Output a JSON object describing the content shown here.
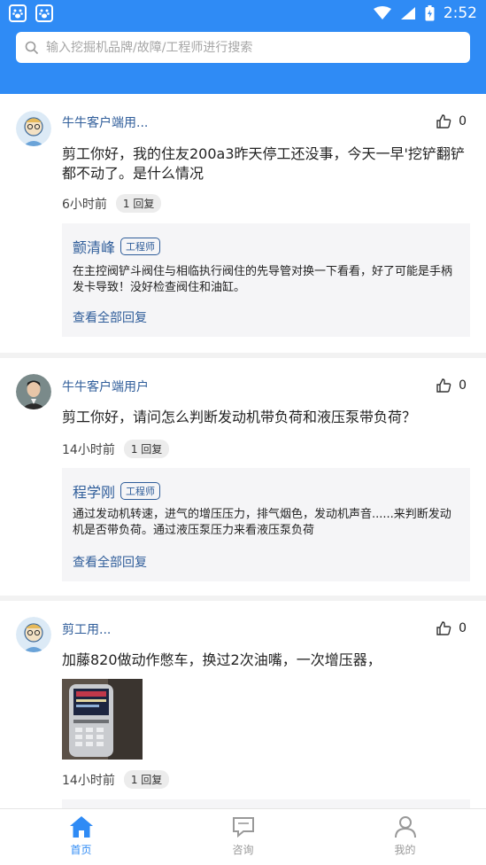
{
  "status_bar": {
    "time": "2:52"
  },
  "search": {
    "placeholder": "输入挖掘机品牌/故障/工程师进行搜索"
  },
  "posts": [
    {
      "user": "牛牛客户端用...",
      "likes": "0",
      "text": "剪工你好，我的住友200a3昨天停工还没事，今天一早'挖铲翻铲都不动了。是什么情况",
      "time": "6小时前",
      "replies": "1 回复",
      "reply": {
        "name": "颤清峰",
        "role": "工程师",
        "text": "在主控阀铲斗阀住与相临执行阀住的先导管对换一下看看，好了可能是手柄发卡导致！没好检查阀住和油缸。",
        "view_all": "查看全部回复"
      }
    },
    {
      "user": "牛牛客户端用户",
      "likes": "0",
      "text": "剪工你好，请问怎么判断发动机带负荷和液压泵带负荷？",
      "time": "14小时前",
      "replies": "1 回复",
      "reply": {
        "name": "程学刚",
        "role": "工程师",
        "text": "通过发动机转速，进气的增压压力，排气烟色，发动机声音......来判断发动机是否带负荷。通过液压泵压力来看液压泵负荷",
        "view_all": "查看全部回复"
      }
    },
    {
      "user": "剪工用...",
      "likes": "0",
      "text": "加藤820做动作憋车，换过2次油嘴，一次增压器，",
      "time": "14小时前",
      "replies": "1 回复"
    }
  ],
  "nav": {
    "home": "首页",
    "consult": "咨询",
    "mine": "我的"
  },
  "colors": {
    "primary": "#2f8bf5",
    "link": "#2f5d9a"
  }
}
